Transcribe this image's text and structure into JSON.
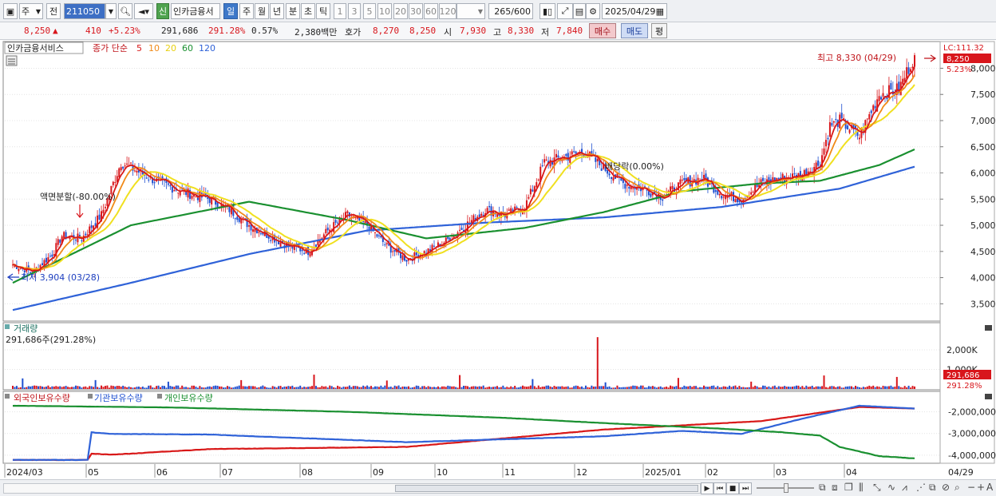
{
  "toolbar": {
    "period_type": "주",
    "prev": "전",
    "stock_code": "211050",
    "credit": "신",
    "stock_name": "인카금융서",
    "periods": [
      "일",
      "주",
      "월",
      "년",
      "분",
      "초",
      "틱"
    ],
    "active_period": "일",
    "intervals": [
      "1",
      "3",
      "5",
      "10",
      "20",
      "30",
      "60",
      "120"
    ],
    "count": "265",
    "count_max": "/600",
    "date": "2025/04/29"
  },
  "info": {
    "price": "8,250",
    "arrow": "▲",
    "change": "410",
    "change_pct": "+5.23%",
    "volume": "291,686",
    "volume_pct": "291.28%",
    "turnover": "0.57%",
    "trade_amount": "2,380백만",
    "quote_label": "호가",
    "ask": "8,270",
    "bid": "8,250",
    "open_label": "시",
    "open": "7,930",
    "high_label": "고",
    "high": "8,330",
    "low_label": "저",
    "low": "7,840",
    "buy_btn": "매수",
    "sell_btn": "매도",
    "avg_btn": "평"
  },
  "colors": {
    "up": "#d8161c",
    "down": "#1e4fd0",
    "ma5": "#d81818",
    "ma10": "#f08a18",
    "ma20": "#f0e020",
    "ma60": "#1a9030",
    "ma120": "#2f62d8"
  },
  "price_panel": {
    "legend_name": "인카금융서비스",
    "legend_ma_label": "종가 단순",
    "ma_periods": [
      "5",
      "10",
      "20",
      "60",
      "120"
    ],
    "lc_label": "LC:111.32",
    "current_price_tag": "8,250",
    "current_pct_tag": "5.23%",
    "high_annotation": "최고 8,330 (04/29)",
    "low_annotation": "최저 3,904 (03/28)",
    "split_annotation": "액면분할(-80.00%)",
    "dividend_annotation": "배당락(0.00%)"
  },
  "volume_panel": {
    "label": "거래량",
    "readout": "291,686주(291.28%)",
    "current_tag": "291,686",
    "current_pct_tag": "291.28%"
  },
  "holdings_panel": {
    "series_labels": [
      "외국인보유수량",
      "기관보유수량",
      "개인보유수량"
    ],
    "ticks": [
      "-2,000,000",
      "-3,000,000",
      "-4,000,000"
    ]
  },
  "chart_data": {
    "type": "candlestick",
    "x_labels": [
      "2024/03",
      "05",
      "06",
      "07",
      "08",
      "09",
      "10",
      "11",
      "12",
      "2025/01",
      "02",
      "03",
      "04",
      "04/29"
    ],
    "y_ticks": [
      "8,000",
      "7,500",
      "7,000",
      "6,500",
      "6,000",
      "5,500",
      "5,000",
      "4,500",
      "4,000",
      "3,500"
    ],
    "ylim": [
      3200,
      8480
    ],
    "volume_ticks": [
      "2,000K",
      "1,000K"
    ],
    "volume_ylim": [
      0,
      2900000
    ],
    "holdings_ylim": [
      -4300000,
      -1500000
    ],
    "close_anchors": [
      [
        0,
        4250
      ],
      [
        10,
        4100
      ],
      [
        20,
        4450
      ],
      [
        25,
        4800
      ],
      [
        35,
        4750
      ],
      [
        45,
        5200
      ],
      [
        55,
        6200
      ],
      [
        65,
        6000
      ],
      [
        75,
        5800
      ],
      [
        90,
        5600
      ],
      [
        100,
        5500
      ],
      [
        110,
        5300
      ],
      [
        120,
        5000
      ],
      [
        130,
        4800
      ],
      [
        140,
        4600
      ],
      [
        150,
        4500
      ],
      [
        160,
        4900
      ],
      [
        170,
        5200
      ],
      [
        180,
        5000
      ],
      [
        190,
        4600
      ],
      [
        200,
        4350
      ],
      [
        210,
        4500
      ],
      [
        220,
        4700
      ],
      [
        230,
        5000
      ],
      [
        240,
        5300
      ],
      [
        250,
        5200
      ],
      [
        260,
        5350
      ],
      [
        270,
        6200
      ],
      [
        280,
        6300
      ],
      [
        290,
        6400
      ],
      [
        300,
        6100
      ],
      [
        310,
        5800
      ],
      [
        320,
        5700
      ],
      [
        330,
        5550
      ],
      [
        340,
        5800
      ],
      [
        350,
        5900
      ],
      [
        360,
        5600
      ],
      [
        370,
        5500
      ],
      [
        380,
        5800
      ],
      [
        390,
        5900
      ],
      [
        400,
        5950
      ],
      [
        410,
        6200
      ],
      [
        415,
        6900
      ],
      [
        420,
        7000
      ],
      [
        430,
        6700
      ],
      [
        440,
        7500
      ],
      [
        450,
        7600
      ],
      [
        458,
        8250
      ]
    ],
    "holdings_foreign_anchors": [
      [
        0,
        -4220000
      ],
      [
        38,
        -4220000
      ],
      [
        40,
        -3930000
      ],
      [
        50,
        -3980000
      ],
      [
        100,
        -3720000
      ],
      [
        200,
        -3620000
      ],
      [
        300,
        -2820000
      ],
      [
        380,
        -2430000
      ],
      [
        430,
        -1780000
      ],
      [
        458,
        -1850000
      ]
    ],
    "holdings_institution_anchors": [
      [
        0,
        -4220000
      ],
      [
        38,
        -4220000
      ],
      [
        40,
        -2950000
      ],
      [
        50,
        -3020000
      ],
      [
        100,
        -3050000
      ],
      [
        200,
        -3400000
      ],
      [
        300,
        -3130000
      ],
      [
        340,
        -2880000
      ],
      [
        370,
        -3020000
      ],
      [
        400,
        -2340000
      ],
      [
        430,
        -1720000
      ],
      [
        458,
        -1850000
      ]
    ],
    "holdings_individual_anchors": [
      [
        0,
        -1720000
      ],
      [
        80,
        -1800000
      ],
      [
        170,
        -2000000
      ],
      [
        250,
        -2280000
      ],
      [
        300,
        -2520000
      ],
      [
        360,
        -2780000
      ],
      [
        390,
        -2940000
      ],
      [
        410,
        -3100000
      ],
      [
        420,
        -3620000
      ],
      [
        440,
        -4050000
      ],
      [
        458,
        -4150000
      ]
    ]
  }
}
